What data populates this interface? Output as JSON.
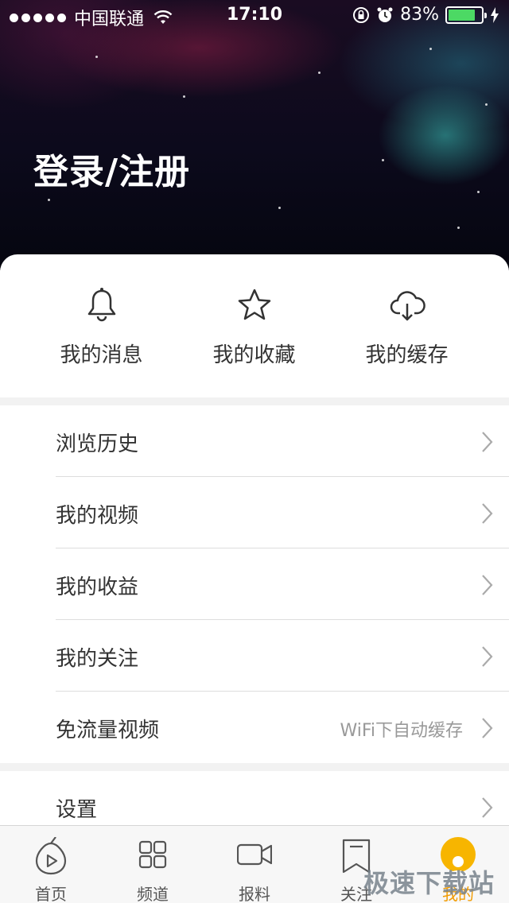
{
  "status_bar": {
    "carrier": "中国联通",
    "time": "17:10",
    "battery_percent": "83%",
    "battery_level": 0.83
  },
  "hero": {
    "login_title": "登录/注册"
  },
  "quick_actions": [
    {
      "label": "我的消息",
      "icon": "bell-icon"
    },
    {
      "label": "我的收藏",
      "icon": "star-icon"
    },
    {
      "label": "我的缓存",
      "icon": "cloud-download-icon"
    }
  ],
  "menu": {
    "items": [
      {
        "label": "浏览历史",
        "detail": ""
      },
      {
        "label": "我的视频",
        "detail": ""
      },
      {
        "label": "我的收益",
        "detail": ""
      },
      {
        "label": "我的关注",
        "detail": ""
      },
      {
        "label": "免流量视频",
        "detail": "WiFi下自动缓存"
      }
    ],
    "settings": {
      "label": "设置"
    }
  },
  "tabbar": {
    "tabs": [
      {
        "label": "首页",
        "icon": "home-play-icon"
      },
      {
        "label": "频道",
        "icon": "grid-icon"
      },
      {
        "label": "报料",
        "icon": "video-camera-icon"
      },
      {
        "label": "关注",
        "icon": "bookmark-icon"
      },
      {
        "label": "我的",
        "icon": "user-avatar-icon",
        "active": true
      }
    ]
  },
  "watermark": "极速下载站",
  "colors": {
    "accent": "#f29b00",
    "avatar": "#f7b500",
    "battery": "#4cd964"
  }
}
